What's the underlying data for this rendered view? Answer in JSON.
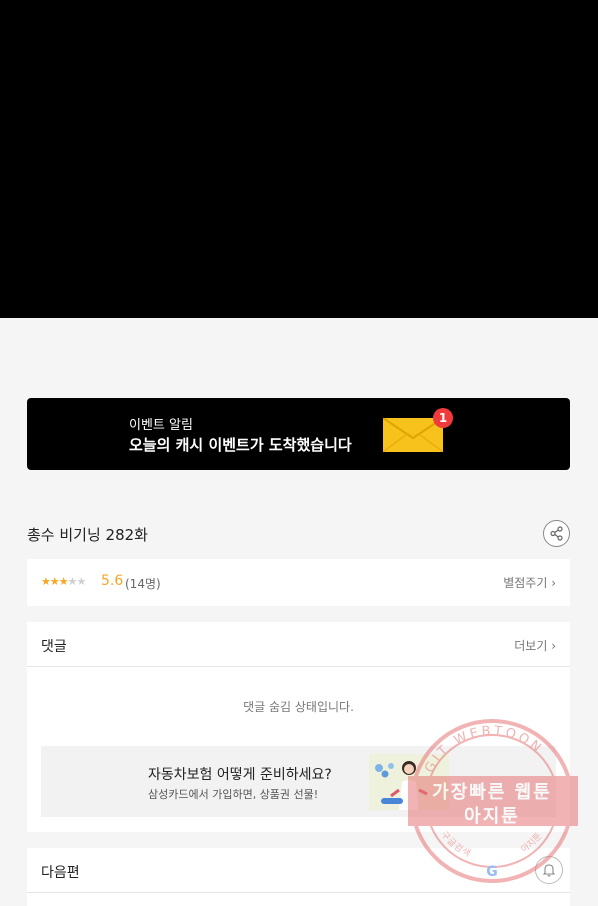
{
  "event_banner": {
    "label": "이벤트 알림",
    "message": "오늘의 캐시 이벤트가 도착했습니다",
    "badge_count": "1",
    "icon": "envelope-icon"
  },
  "episode": {
    "title": "총수 비기닝 282화"
  },
  "rating": {
    "stars_filled": 3,
    "stars_total": 5,
    "score": "5.6",
    "count": "(14명)",
    "rate_label": "별점주기 ›"
  },
  "comments": {
    "title": "댓글",
    "more_label": "더보기 ›",
    "hidden_message": "댓글 숨김 상태입니다."
  },
  "ad": {
    "title": "자동차보험 어떻게 준비하세요?",
    "subtitle": "삼성카드에서 가입하면, 상품권 선물!"
  },
  "next": {
    "title": "다음편"
  },
  "watermark": {
    "ring_text": "AGIT WEBTOON",
    "line1": "가장빠른 웹툰",
    "line2": "아지툰",
    "bottom_text": "구글검색 아지툰"
  },
  "colors": {
    "accent_star": "#f5a623",
    "badge": "#ef3b3b",
    "watermark": "#e67676"
  }
}
